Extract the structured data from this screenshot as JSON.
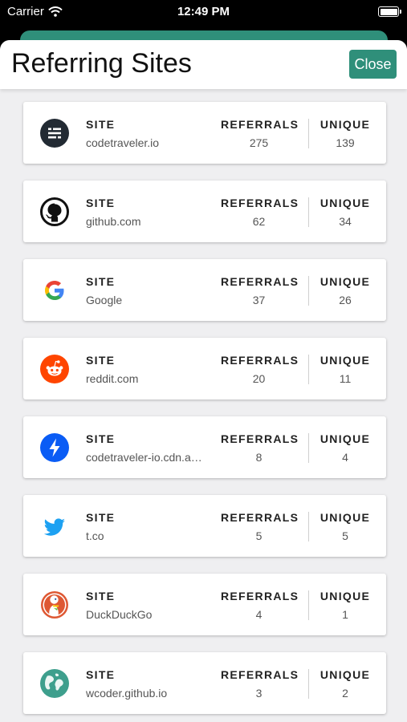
{
  "status_bar": {
    "carrier": "Carrier",
    "time": "12:49 PM"
  },
  "header": {
    "title": "Referring Sites",
    "close_label": "Close"
  },
  "columns": {
    "site": "SITE",
    "referrals": "REFERRALS",
    "unique": "UNIQUE"
  },
  "sites": [
    {
      "name": "codetraveler.io",
      "referrals": "275",
      "unique": "139",
      "icon": "codetraveler-logo-icon"
    },
    {
      "name": "github.com",
      "referrals": "62",
      "unique": "34",
      "icon": "github-icon"
    },
    {
      "name": "Google",
      "referrals": "37",
      "unique": "26",
      "icon": "google-icon"
    },
    {
      "name": "reddit.com",
      "referrals": "20",
      "unique": "11",
      "icon": "reddit-icon"
    },
    {
      "name": "codetraveler-io.cdn.ampproject.org",
      "referrals": "8",
      "unique": "4",
      "icon": "amp-icon"
    },
    {
      "name": "t.co",
      "referrals": "5",
      "unique": "5",
      "icon": "twitter-icon"
    },
    {
      "name": "DuckDuckGo",
      "referrals": "4",
      "unique": "1",
      "icon": "duckduckgo-icon"
    },
    {
      "name": "wcoder.github.io",
      "referrals": "3",
      "unique": "2",
      "icon": "globe-icon"
    }
  ],
  "colors": {
    "accent": "#2f8f7a",
    "background": "#efeff1"
  }
}
